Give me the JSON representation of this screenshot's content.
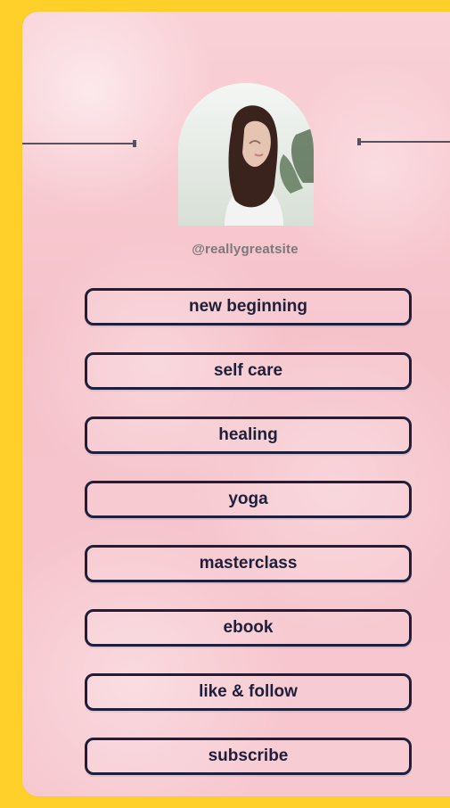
{
  "colors": {
    "background": "#ffd02a",
    "card": "#f7c7cf",
    "text_dark": "#1e1f3a",
    "text_muted": "#7a7a7a"
  },
  "profile": {
    "handle": "@reallygreatsite",
    "avatar": "profile-photo"
  },
  "buttons": [
    {
      "label": "new beginning"
    },
    {
      "label": "self care"
    },
    {
      "label": "healing"
    },
    {
      "label": "yoga"
    },
    {
      "label": "masterclass"
    },
    {
      "label": "ebook"
    },
    {
      "label": "like & follow"
    },
    {
      "label": "subscribe"
    }
  ]
}
